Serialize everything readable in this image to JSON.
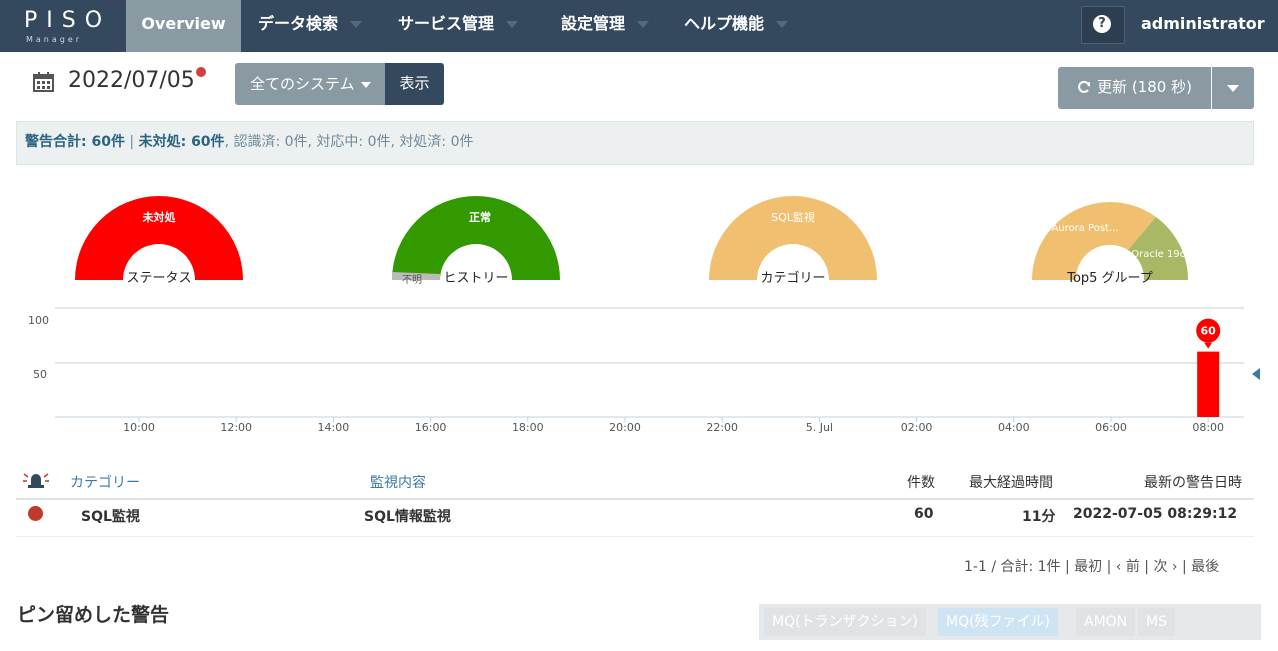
{
  "nav": {
    "logo_main": "PISO",
    "logo_sub": "Manager",
    "items": [
      {
        "label": "Overview"
      },
      {
        "label": "データ検索"
      },
      {
        "label": "サービス管理"
      },
      {
        "label": "設定管理"
      },
      {
        "label": "ヘルプ機能"
      }
    ],
    "help": "?",
    "user": "administrator"
  },
  "toolbar": {
    "date": "2022/07/05",
    "system_select": "全てのシステム",
    "show_button": "表示",
    "refresh_button": "更新 (180 秒)"
  },
  "alerts": {
    "total_label": "警告合計: 60件",
    "unhandled_label": "未対処: 60件",
    "rest": ", 認識済: 0件, 対応中: 0件, 対処済: 0件"
  },
  "gauges": [
    {
      "label": "ステータス",
      "segments": [
        {
          "name": "未対処",
          "fraction": 1.0,
          "color": "#ff0000"
        }
      ]
    },
    {
      "label": "ヒストリー",
      "segments": [
        {
          "name": "不明",
          "fraction": 0.03,
          "color": "#bbbbbb"
        },
        {
          "name": "正常",
          "fraction": 0.97,
          "color": "#339900"
        }
      ]
    },
    {
      "label": "カテゴリー",
      "segments": [
        {
          "name": "SQL監視",
          "fraction": 1.0,
          "color": "#f0c070"
        }
      ]
    },
    {
      "label": "Top5 グループ",
      "segments": [
        {
          "name": "Aurora Post...",
          "fraction": 0.8,
          "color": "#f0c070"
        },
        {
          "name": "Oracle 19c...",
          "fraction": 0.2,
          "color": "#a8b865"
        }
      ]
    }
  ],
  "chart_data": {
    "type": "bar",
    "x": [
      "08:00"
    ],
    "values": [
      60
    ],
    "x_ticks": [
      "10:00",
      "12:00",
      "14:00",
      "16:00",
      "18:00",
      "20:00",
      "22:00",
      "5. Jul",
      "02:00",
      "04:00",
      "06:00",
      "08:00"
    ],
    "y_ticks": [
      "50",
      "100"
    ],
    "ylim": [
      0,
      100
    ],
    "data_label": "60",
    "color": "#ff0000"
  },
  "table": {
    "headers": {
      "category": "カテゴリー",
      "content": "監視内容",
      "count": "件数",
      "max_elapsed": "最大経過時間",
      "latest": "最新の警告日時"
    },
    "rows": [
      {
        "category": "SQL監視",
        "content": "SQL情報監視",
        "count": "60",
        "max_elapsed": "11分",
        "latest": "2022-07-05 08:29:12"
      }
    ]
  },
  "pager": "1-1 / 合計: 1件 | 最初 | ‹ 前 | 次 › | 最後",
  "pinned": {
    "title": "ピン留めした警告",
    "tabs": [
      "MQ(トランザクション)",
      "MQ(残ファイル)",
      "AMON",
      "MS"
    ]
  }
}
